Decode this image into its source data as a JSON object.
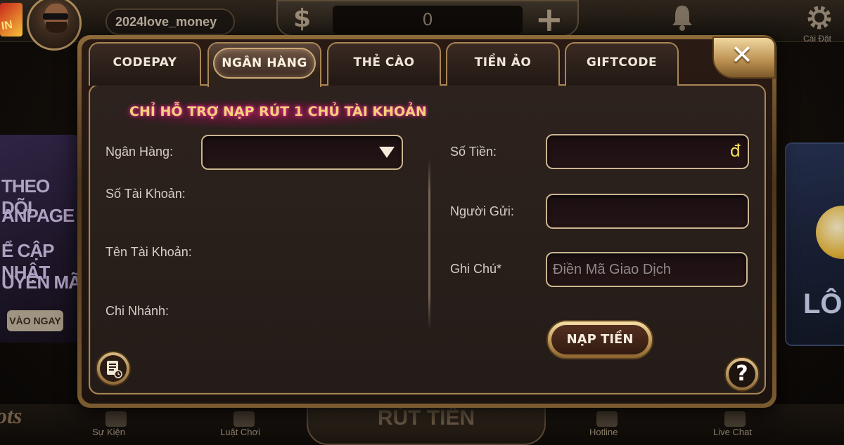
{
  "header": {
    "logo_text": "IN",
    "username": "2024love_money",
    "coin_symbol": "$",
    "balance": "0",
    "add_symbol": "+",
    "settings_label": "Cài Đặt"
  },
  "background": {
    "left_banner_lines": [
      "THEO DÕI",
      "ANPAGE",
      "Ể CẬP NHẬT",
      "UYỂN MÃ"
    ],
    "left_banner_button": "VÀO NGAY",
    "right_banner_text": "LÔ",
    "center_bottom": "RÚT TIỀN",
    "bottom_left_text": "ots",
    "bottom_nav": [
      "Sự Kiện",
      "Luật Chơi",
      "Hotline",
      "Live Chat"
    ]
  },
  "modal": {
    "tabs": [
      {
        "label": "CODEPAY",
        "active": false
      },
      {
        "label": "NGÂN HÀNG",
        "active": true
      },
      {
        "label": "THẺ CÀO",
        "active": false
      },
      {
        "label": "TIỀN ẢO",
        "active": false
      },
      {
        "label": "GIFTCODE",
        "active": false
      }
    ],
    "close_symbol": "✕",
    "notice": "CHỈ HỖ TRỢ NẠP RÚT 1 CHỦ TÀI KHOẢN",
    "left_form": {
      "bank_label": "Ngân Hàng:",
      "bank_value": "",
      "account_number_label": "Số Tài Khoản:",
      "account_name_label": "Tên Tài Khoản:",
      "branch_label": "Chi Nhánh:"
    },
    "right_form": {
      "amount_label": "Số Tiền:",
      "amount_currency": "đ",
      "amount_value": "",
      "sender_label": "Người Gửi:",
      "sender_value": "",
      "note_label": "Ghi Chú*",
      "note_placeholder": "Điền Mã Giao Dịch"
    },
    "submit_label": "NẠP TIỀN",
    "help_symbol": "?"
  },
  "colors": {
    "frame_gold": "#a88556",
    "panel_bg": "#2d221e",
    "notice_text": "#f2d27a",
    "notice_glow": "#ff3aa0",
    "currency_yellow": "#f4e15a"
  }
}
